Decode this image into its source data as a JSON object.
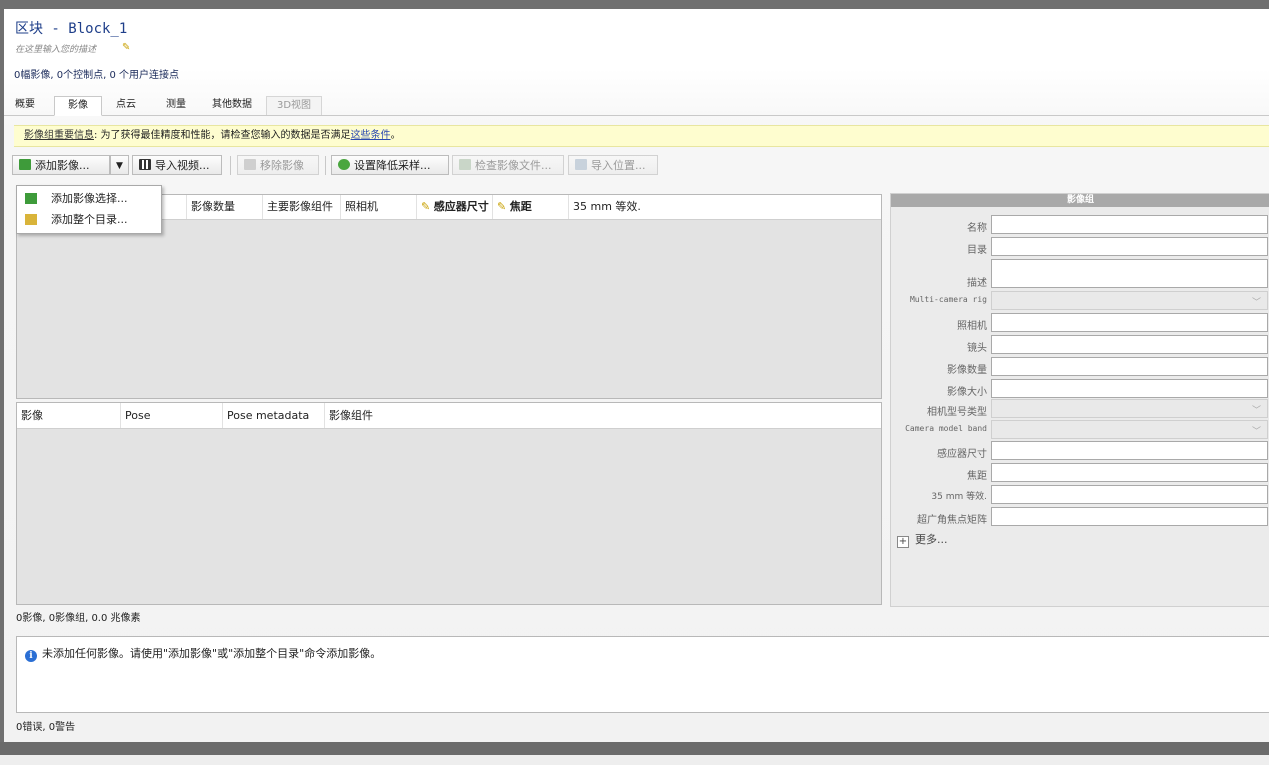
{
  "header": {
    "title": "区块 - Block_1",
    "description_placeholder": "在这里输入您的描述",
    "summary": "0幅影像, 0个控制点, 0 个用户连接点"
  },
  "tabs": [
    {
      "label": "概要",
      "active": false,
      "disabled": false
    },
    {
      "label": "影像",
      "active": true,
      "disabled": false
    },
    {
      "label": "点云",
      "active": false,
      "disabled": false
    },
    {
      "label": "测量",
      "active": false,
      "disabled": false
    },
    {
      "label": "其他数据",
      "active": false,
      "disabled": false
    },
    {
      "label": "3D视图",
      "active": false,
      "disabled": true
    }
  ],
  "banner": {
    "heading": "影像组重要信息",
    "text": ": 为了获得最佳精度和性能，请检查您输入的数据是否满足",
    "link": "这些条件",
    "suffix": "。"
  },
  "toolbar": {
    "add_photos": "添加影像...",
    "import_video": "导入视频...",
    "remove_photos": "移除影像",
    "set_downsampling": "设置降低采样...",
    "check_files": "检查影像文件...",
    "import_positions": "导入位置..."
  },
  "add_menu": {
    "items": [
      "添加影像选择...",
      "添加整个目录..."
    ]
  },
  "photogroups_table": {
    "columns": [
      "影像数量",
      "主要影像组件",
      "照相机",
      "感应器尺寸",
      "焦距",
      "35 mm 等效."
    ]
  },
  "photos_table": {
    "columns": [
      "影像",
      "Pose",
      "Pose metadata",
      "影像组件"
    ]
  },
  "grid_status": "0影像, 0影像组, 0.0 兆像素",
  "messages": {
    "info": "未添加任何影像。请使用\"添加影像\"或\"添加整个目录\"命令添加影像。",
    "status": "0错误, 0警告"
  },
  "panel": {
    "title": "影像组",
    "fields": [
      {
        "label": "名称",
        "type": "text"
      },
      {
        "label": "目录",
        "type": "text"
      },
      {
        "label": "描述",
        "type": "textarea"
      },
      {
        "label": "Multi-camera rig",
        "type": "combo"
      },
      {
        "label": "照相机",
        "type": "text"
      },
      {
        "label": "镜头",
        "type": "text"
      },
      {
        "label": "影像数量",
        "type": "text"
      },
      {
        "label": "影像大小",
        "type": "text"
      },
      {
        "label": "相机型号类型",
        "type": "combo"
      },
      {
        "label": "Camera model band",
        "type": "combo"
      },
      {
        "label": "感应器尺寸",
        "type": "text"
      },
      {
        "label": "焦距",
        "type": "text"
      },
      {
        "label": "35 mm 等效.",
        "type": "text"
      },
      {
        "label": "超广角焦点矩阵",
        "type": "text"
      }
    ],
    "more": "更多..."
  },
  "colors": {
    "accent": "#1f3f8a",
    "banner_bg": "#fefdcf",
    "grid_bg": "#e3e3e3",
    "panel_header": "#a9a9a9",
    "info_icon": "#2b6fd4"
  }
}
